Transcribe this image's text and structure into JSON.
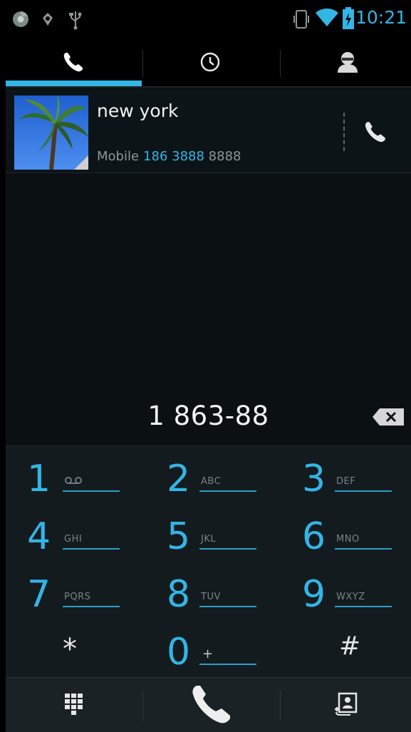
{
  "status_bar": {
    "time": "10:21",
    "icons": [
      "chrome-icon",
      "android-debug-icon",
      "usb-icon",
      "vibrate-icon",
      "wifi-icon",
      "battery-charging-icon"
    ]
  },
  "tabs": [
    {
      "name": "dialer",
      "icon": "phone-icon",
      "selected": true
    },
    {
      "name": "call-log",
      "icon": "clock-icon",
      "selected": false
    },
    {
      "name": "contacts",
      "icon": "person-icon",
      "selected": false
    }
  ],
  "contact_match": {
    "name": "new york",
    "number_type": "Mobile",
    "number_matched": "186 3888",
    "number_rest": " 8888",
    "photo": "palm-tree-photo"
  },
  "dial": {
    "number": "1 863-88"
  },
  "keypad": {
    "keys": [
      {
        "digit": "1",
        "letters": "ᴼᴼ"
      },
      {
        "digit": "2",
        "letters": "ABC"
      },
      {
        "digit": "3",
        "letters": "DEF"
      },
      {
        "digit": "4",
        "letters": "GHI"
      },
      {
        "digit": "5",
        "letters": "JKL"
      },
      {
        "digit": "6",
        "letters": "MNO"
      },
      {
        "digit": "7",
        "letters": "PQRS"
      },
      {
        "digit": "8",
        "letters": "TUV"
      },
      {
        "digit": "9",
        "letters": "WXYZ"
      },
      {
        "digit": "*",
        "letters": ""
      },
      {
        "digit": "0",
        "letters": "+"
      },
      {
        "digit": "#",
        "letters": ""
      }
    ]
  },
  "colors": {
    "accent": "#33b5e5",
    "background": "#0b1013",
    "keypad_bg": "#131b1f"
  }
}
